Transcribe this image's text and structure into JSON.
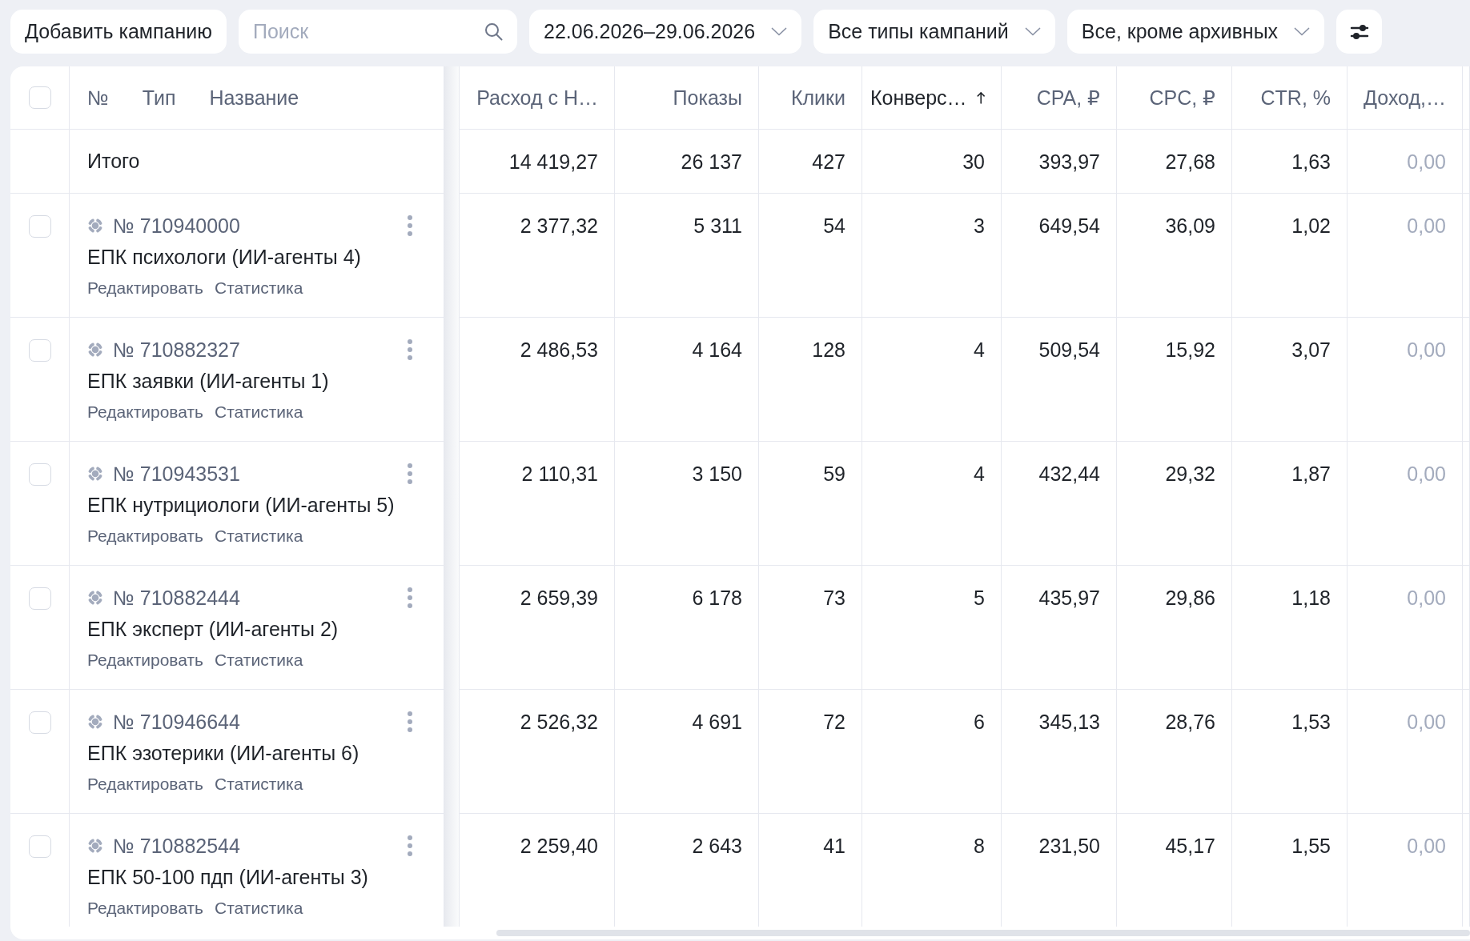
{
  "toolbar": {
    "add_button": "Добавить кампанию",
    "search": {
      "placeholder": "Поиск"
    },
    "filters": [
      {
        "label": "22.06.2026–29.06.2026"
      },
      {
        "label": "Все типы кампаний"
      },
      {
        "label": "Все, кроме архивных"
      }
    ]
  },
  "table": {
    "select_all": {
      "checked": false
    },
    "fixed_columns": [
      "№",
      "Тип",
      "Название"
    ],
    "columns": [
      {
        "label": "Расход с Н…",
        "sorted": false,
        "muted": false
      },
      {
        "label": "Показы",
        "sorted": false,
        "muted": false
      },
      {
        "label": "Клики",
        "sorted": false,
        "muted": false
      },
      {
        "label": "Конверс…",
        "sorted": true,
        "muted": false
      },
      {
        "label": "CPA, ₽",
        "sorted": false,
        "muted": false
      },
      {
        "label": "CPC, ₽",
        "sorted": false,
        "muted": false
      },
      {
        "label": "CTR, %",
        "sorted": false,
        "muted": false
      },
      {
        "label": "Доход,…",
        "sorted": false,
        "muted": true
      }
    ],
    "total": {
      "label": "Итого",
      "values": [
        "14 419,27",
        "26 137",
        "427",
        "30",
        "393,97",
        "27,68",
        "1,63",
        "0,00"
      ]
    },
    "rows": [
      {
        "checked": false,
        "number": "№ 710940000",
        "name": "ЕПК психологи (ИИ-агенты 4)",
        "actions": [
          "Редактировать",
          "Статистика"
        ],
        "values": [
          "2 377,32",
          "5 311",
          "54",
          "3",
          "649,54",
          "36,09",
          "1,02",
          "0,00"
        ]
      },
      {
        "checked": false,
        "number": "№ 710882327",
        "name": "ЕПК заявки (ИИ-агенты 1)",
        "actions": [
          "Редактировать",
          "Статистика"
        ],
        "values": [
          "2 486,53",
          "4 164",
          "128",
          "4",
          "509,54",
          "15,92",
          "3,07",
          "0,00"
        ]
      },
      {
        "checked": false,
        "number": "№ 710943531",
        "name": "ЕПК нутрициологи (ИИ-агенты 5)",
        "actions": [
          "Редактировать",
          "Статистика"
        ],
        "values": [
          "2 110,31",
          "3 150",
          "59",
          "4",
          "432,44",
          "29,32",
          "1,87",
          "0,00"
        ]
      },
      {
        "checked": false,
        "number": "№ 710882444",
        "name": "ЕПК эксперт (ИИ-агенты 2)",
        "actions": [
          "Редактировать",
          "Статистика"
        ],
        "values": [
          "2 659,39",
          "6 178",
          "73",
          "5",
          "435,97",
          "29,86",
          "1,18",
          "0,00"
        ]
      },
      {
        "checked": false,
        "number": "№ 710946644",
        "name": "ЕПК эзотерики (ИИ-агенты 6)",
        "actions": [
          "Редактировать",
          "Статистика"
        ],
        "values": [
          "2 526,32",
          "4 691",
          "72",
          "6",
          "345,13",
          "28,76",
          "1,53",
          "0,00"
        ]
      },
      {
        "checked": false,
        "number": "№ 710882544",
        "name": "ЕПК 50-100 пдп (ИИ-агенты 3)",
        "actions": [
          "Редактировать",
          "Статистика"
        ],
        "values": [
          "2 259,40",
          "2 643",
          "41",
          "8",
          "231,50",
          "45,17",
          "1,55",
          "0,00"
        ]
      }
    ]
  }
}
